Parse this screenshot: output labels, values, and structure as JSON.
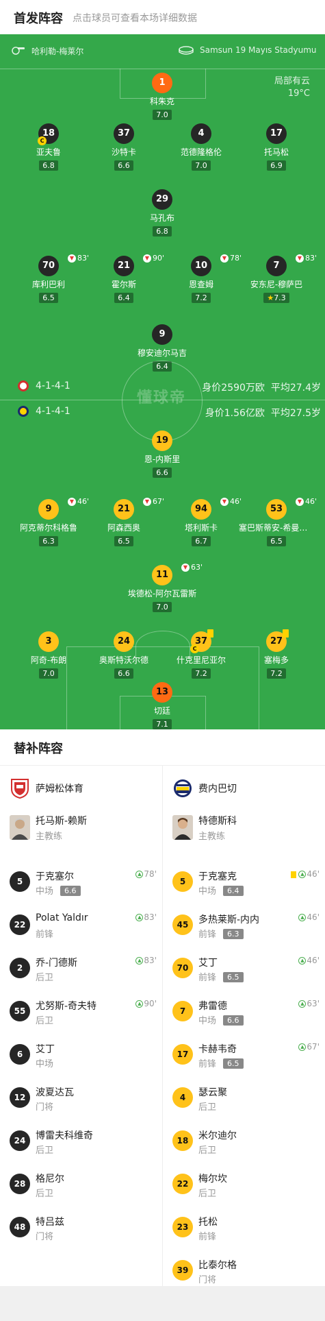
{
  "header": {
    "title": "首发阵容",
    "subtitle": "点击球员可查看本场详细数据"
  },
  "match_info": {
    "referee": "哈利勒-梅莱尔",
    "stadium": "Samsun 19 Mayıs Stadyumu",
    "weather": "局部有云",
    "temperature": "19°C",
    "watermark": "懂球帝"
  },
  "home": {
    "formation": "4-1-4-1",
    "value": "身价2590万欧",
    "avg_age": "平均27.4岁",
    "players": [
      {
        "num": "1",
        "name": "科朱克",
        "rating": "7.0"
      },
      {
        "num": "18",
        "name": "亚夫鲁",
        "rating": "6.8",
        "captain": "C"
      },
      {
        "num": "37",
        "name": "沙特卡",
        "rating": "6.6"
      },
      {
        "num": "4",
        "name": "范德隆格伦",
        "rating": "7.0"
      },
      {
        "num": "17",
        "name": "托马松",
        "rating": "6.9"
      },
      {
        "num": "29",
        "name": "马孔布",
        "rating": "6.8"
      },
      {
        "num": "70",
        "name": "库利巴利",
        "rating": "6.5",
        "sub": "83'"
      },
      {
        "num": "21",
        "name": "霍尔斯",
        "rating": "6.4",
        "sub": "90'"
      },
      {
        "num": "10",
        "name": "恩查姆",
        "rating": "7.2",
        "sub": "78'"
      },
      {
        "num": "7",
        "name": "安东尼-穆萨巴",
        "rating": "7.3",
        "sub": "83'",
        "mvp": "★"
      },
      {
        "num": "9",
        "name": "穆安迪尔马吉",
        "rating": "6.4"
      }
    ]
  },
  "away": {
    "formation": "4-1-4-1",
    "value": "身价1.56亿欧",
    "avg_age": "平均27.5岁",
    "players": [
      {
        "num": "19",
        "name": "恩-内斯里",
        "rating": "6.6"
      },
      {
        "num": "9",
        "name": "阿克蒂尔科格鲁",
        "rating": "6.3",
        "sub": "46'"
      },
      {
        "num": "21",
        "name": "阿森西奥",
        "rating": "6.5",
        "sub": "67'"
      },
      {
        "num": "94",
        "name": "塔利斯卡",
        "rating": "6.7",
        "sub": "46'"
      },
      {
        "num": "53",
        "name": "塞巴斯蒂安-希曼斯基",
        "rating": "6.5",
        "sub": "46'"
      },
      {
        "num": "11",
        "name": "埃德松-阿尔瓦雷斯",
        "rating": "7.0",
        "sub": "63'"
      },
      {
        "num": "3",
        "name": "阿奇-布朗",
        "rating": "7.0"
      },
      {
        "num": "24",
        "name": "奥斯特沃尔德",
        "rating": "6.6"
      },
      {
        "num": "37",
        "name": "什克里尼亚尔",
        "rating": "7.2",
        "captain": "C"
      },
      {
        "num": "27",
        "name": "塞梅多",
        "rating": "7.2"
      },
      {
        "num": "13",
        "name": "切廷",
        "rating": "7.1"
      }
    ]
  },
  "bench": {
    "title": "替补阵容",
    "home": {
      "team": "萨姆松体育",
      "coach": {
        "name": "托马斯-赖斯",
        "role": "主教练"
      },
      "subs": [
        {
          "num": "5",
          "name": "于克塞尔",
          "pos": "中场",
          "rating": "6.6",
          "in": "78'"
        },
        {
          "num": "22",
          "name": "Polat Yaldır",
          "pos": "前锋",
          "in": "83'"
        },
        {
          "num": "2",
          "name": "乔-门德斯",
          "pos": "后卫",
          "in": "83'"
        },
        {
          "num": "55",
          "name": "尤努斯-奇夫特",
          "pos": "后卫",
          "in": "90'"
        },
        {
          "num": "6",
          "name": "艾丁",
          "pos": "中场"
        },
        {
          "num": "12",
          "name": "波夏达瓦",
          "pos": "门将"
        },
        {
          "num": "24",
          "name": "博雷夫科维奇",
          "pos": "后卫"
        },
        {
          "num": "28",
          "name": "格尼尔",
          "pos": "后卫"
        },
        {
          "num": "48",
          "name": "特吕兹",
          "pos": "门将"
        }
      ]
    },
    "away": {
      "team": "费内巴切",
      "coach": {
        "name": "特德斯科",
        "role": "主教练"
      },
      "subs": [
        {
          "num": "5",
          "name": "于克塞克",
          "pos": "中场",
          "rating": "6.4",
          "in": "46'",
          "yellow": true
        },
        {
          "num": "45",
          "name": "多热莱斯-内内",
          "pos": "前锋",
          "rating": "6.3",
          "in": "46'"
        },
        {
          "num": "70",
          "name": "艾丁",
          "pos": "前锋",
          "rating": "6.5",
          "in": "46'"
        },
        {
          "num": "7",
          "name": "弗雷德",
          "pos": "中场",
          "rating": "6.6",
          "in": "63'"
        },
        {
          "num": "17",
          "name": "卡赫韦奇",
          "pos": "前锋",
          "rating": "6.5",
          "in": "67'"
        },
        {
          "num": "4",
          "name": "瑟云聚",
          "pos": "后卫"
        },
        {
          "num": "18",
          "name": "米尔迪尔",
          "pos": "后卫"
        },
        {
          "num": "22",
          "name": "梅尔坎",
          "pos": "后卫"
        },
        {
          "num": "23",
          "name": "托松",
          "pos": "前锋"
        },
        {
          "num": "39",
          "name": "比泰尔格",
          "pos": "门将"
        }
      ]
    }
  }
}
